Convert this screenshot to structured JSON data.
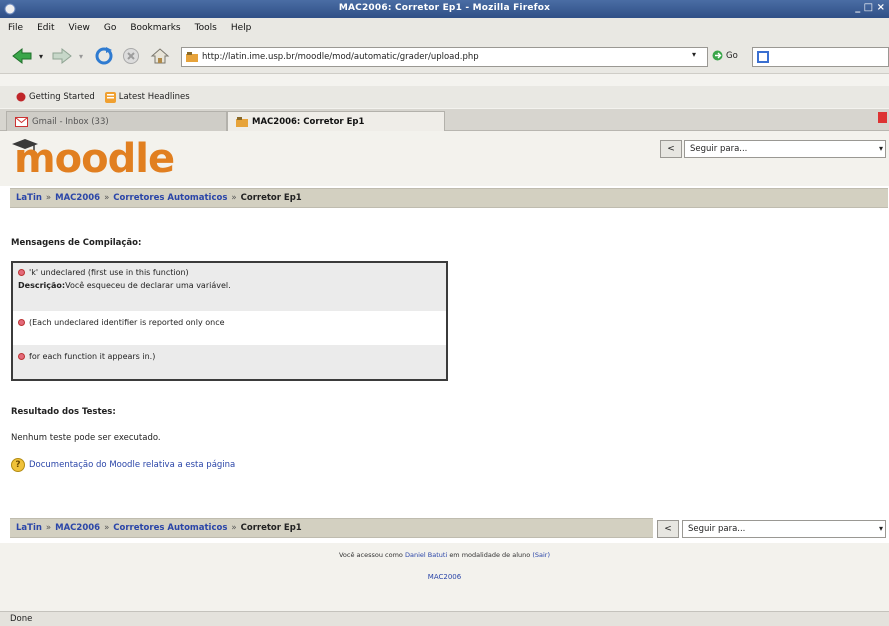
{
  "window": {
    "title": "MAC2006: Corretor Ep1 - Mozilla Firefox",
    "controls": "_ □ ×"
  },
  "menu": [
    "File",
    "Edit",
    "View",
    "Go",
    "Bookmarks",
    "Tools",
    "Help"
  ],
  "nav": {
    "url": "http://latin.ime.usp.br/moodle/mod/automatic/grader/upload.php",
    "go_label": "Go"
  },
  "bookmarks": [
    {
      "label": "Getting Started"
    },
    {
      "label": "Latest Headlines"
    }
  ],
  "tabs": [
    {
      "label": "Gmail - Inbox (33)",
      "active": false
    },
    {
      "label": "MAC2006: Corretor Ep1",
      "active": true
    }
  ],
  "page": {
    "logo": "moodle",
    "jump_prev": "<",
    "jump_select": "Seguir para...",
    "breadcrumb": [
      {
        "label": "LaTin",
        "link": true
      },
      {
        "label": "MAC2006",
        "link": true
      },
      {
        "label": "Corretores Automaticos",
        "link": true
      },
      {
        "label": "Corretor Ep1",
        "link": false
      }
    ],
    "breadcrumb_sep": "»",
    "compilation_title": "Mensagens de Compilação:",
    "messages": [
      {
        "text": "'k' undeclared (first use in this function)",
        "desc_label": "Descrição:",
        "desc": "Você esqueceu de declarar uma variável."
      },
      {
        "text": "(Each undeclared identifier is reported only once"
      },
      {
        "text": "for each function it appears in.)"
      }
    ],
    "tests_title": "Resultado dos Testes:",
    "tests_result": "Nenhum teste pode ser executado.",
    "doc_link": "Documentação do Moodle relativa a esta página",
    "footer_login_prefix": "Você acessou como",
    "footer_login_user": "Daniel Batuti",
    "footer_login_suffix": "em modalidade de aluno",
    "footer_logout": "(Sair)",
    "footer_course": "MAC2006"
  },
  "status": "Done"
}
